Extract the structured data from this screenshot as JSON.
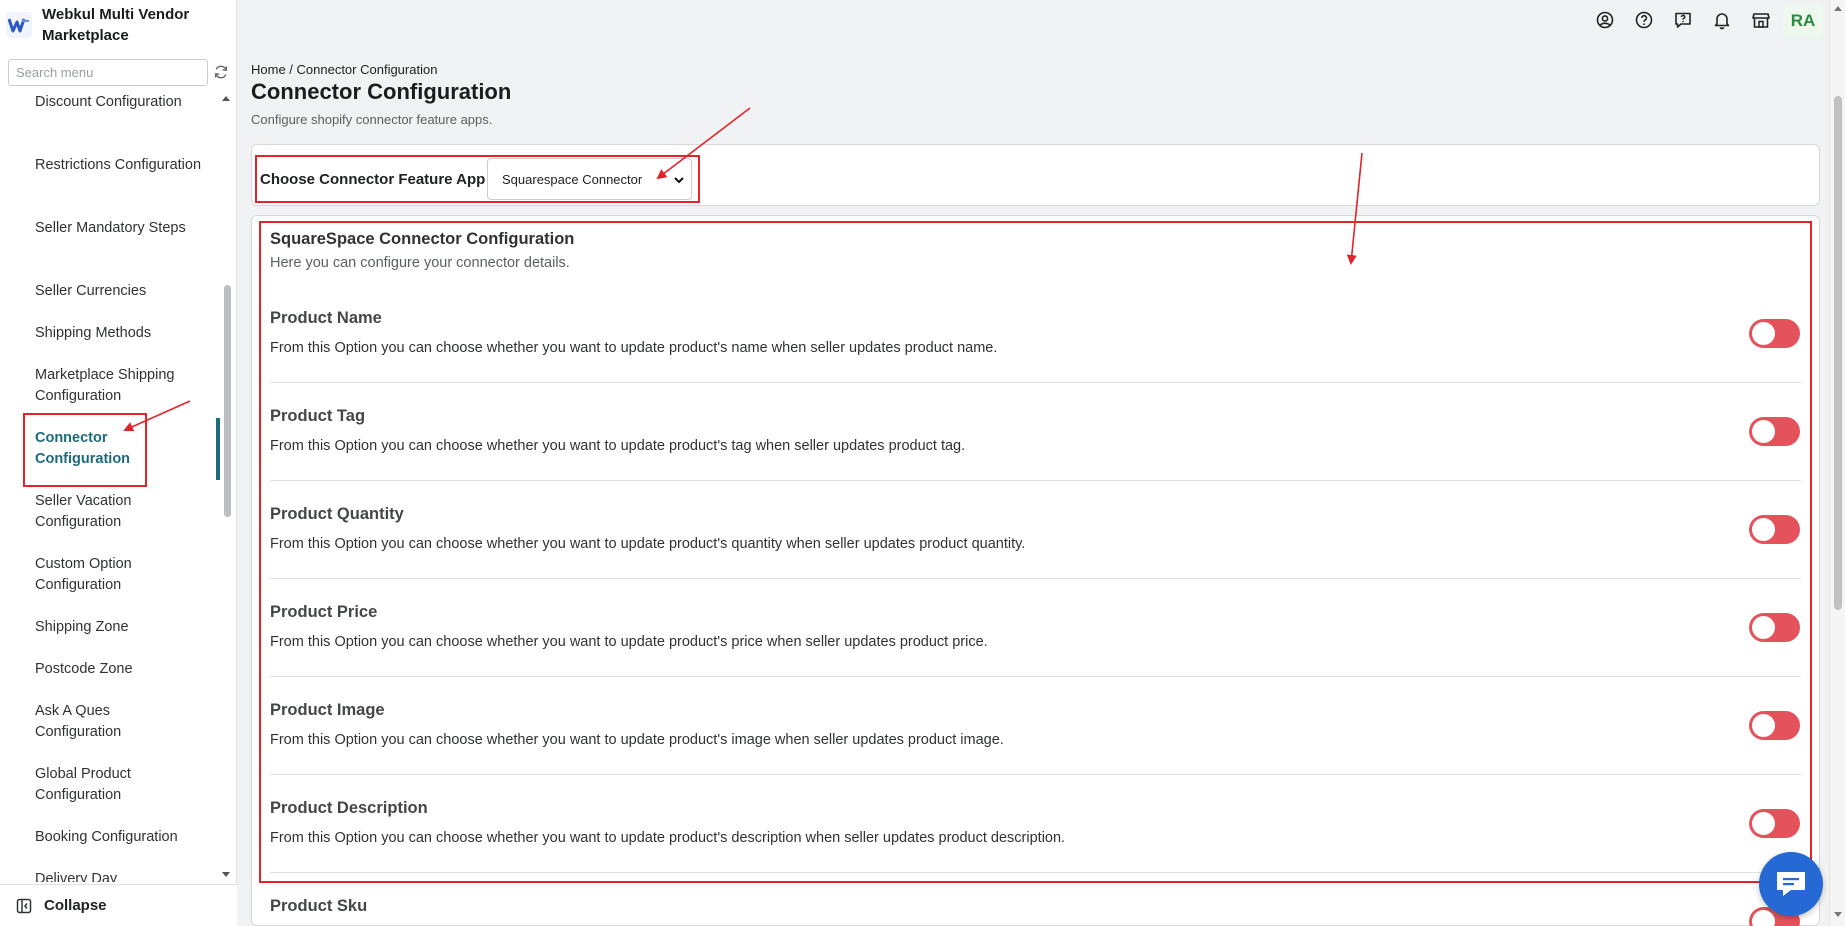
{
  "app": {
    "brand_name": "Webkul Multi Vendor Marketplace",
    "brand_logo_letter": "W"
  },
  "sidebar": {
    "search_placeholder": "Search menu",
    "items": [
      {
        "label": "Discount Configuration",
        "active": false
      },
      {
        "label": "Restrictions Configuration",
        "active": false
      },
      {
        "label": "Seller Mandatory Steps",
        "active": false
      },
      {
        "label": "Seller Currencies",
        "active": false
      },
      {
        "label": "Shipping Methods",
        "active": false
      },
      {
        "label": "Marketplace Shipping Configuration",
        "active": false
      },
      {
        "label": "Connector Configuration",
        "active": true
      },
      {
        "label": "Seller Vacation Configuration",
        "active": false
      },
      {
        "label": "Custom Option Configuration",
        "active": false
      },
      {
        "label": "Shipping Zone",
        "active": false
      },
      {
        "label": "Postcode Zone",
        "active": false
      },
      {
        "label": "Ask A Ques Configuration",
        "active": false
      },
      {
        "label": "Global Product Configuration",
        "active": false
      },
      {
        "label": "Booking Configuration",
        "active": false
      },
      {
        "label": "Delivery Day",
        "active": false
      }
    ],
    "collapse_label": "Collapse"
  },
  "topbar": {
    "icons": [
      "user-circle-icon",
      "help-icon",
      "feedback-icon",
      "bell-icon",
      "store-icon"
    ],
    "avatar_initials": "RA"
  },
  "header": {
    "breadcrumb": "Home / Connector Configuration",
    "title": "Connector Configuration",
    "subtitle": "Configure shopify connector feature apps."
  },
  "choose_app": {
    "label": "Choose Connector Feature App",
    "selected": "Squarespace Connector"
  },
  "config": {
    "title": "SquareSpace Connector Configuration",
    "description": "Here you can configure your connector details.",
    "options": [
      {
        "title": "Product Name",
        "description": "From this Option you can choose whether you want to update product's name when seller updates product name.",
        "enabled": false
      },
      {
        "title": "Product Tag",
        "description": "From this Option you can choose whether you want to update product's tag when seller updates product tag.",
        "enabled": false
      },
      {
        "title": "Product Quantity",
        "description": "From this Option you can choose whether you want to update product's quantity when seller updates product quantity.",
        "enabled": false
      },
      {
        "title": "Product Price",
        "description": "From this Option you can choose whether you want to update product's price when seller updates product price.",
        "enabled": false
      },
      {
        "title": "Product Image",
        "description": "From this Option you can choose whether you want to update product's image when seller updates product image.",
        "enabled": false
      },
      {
        "title": "Product Description",
        "description": "From this Option you can choose whether you want to update product's description when seller updates product description.",
        "enabled": false
      },
      {
        "title": "Product Sku",
        "description": "",
        "enabled": false
      }
    ]
  },
  "colors": {
    "accent": "#1d6b7a",
    "toggle_off": "#e4525b",
    "annotation": "#e0242b",
    "chat_button": "#2469d4"
  }
}
